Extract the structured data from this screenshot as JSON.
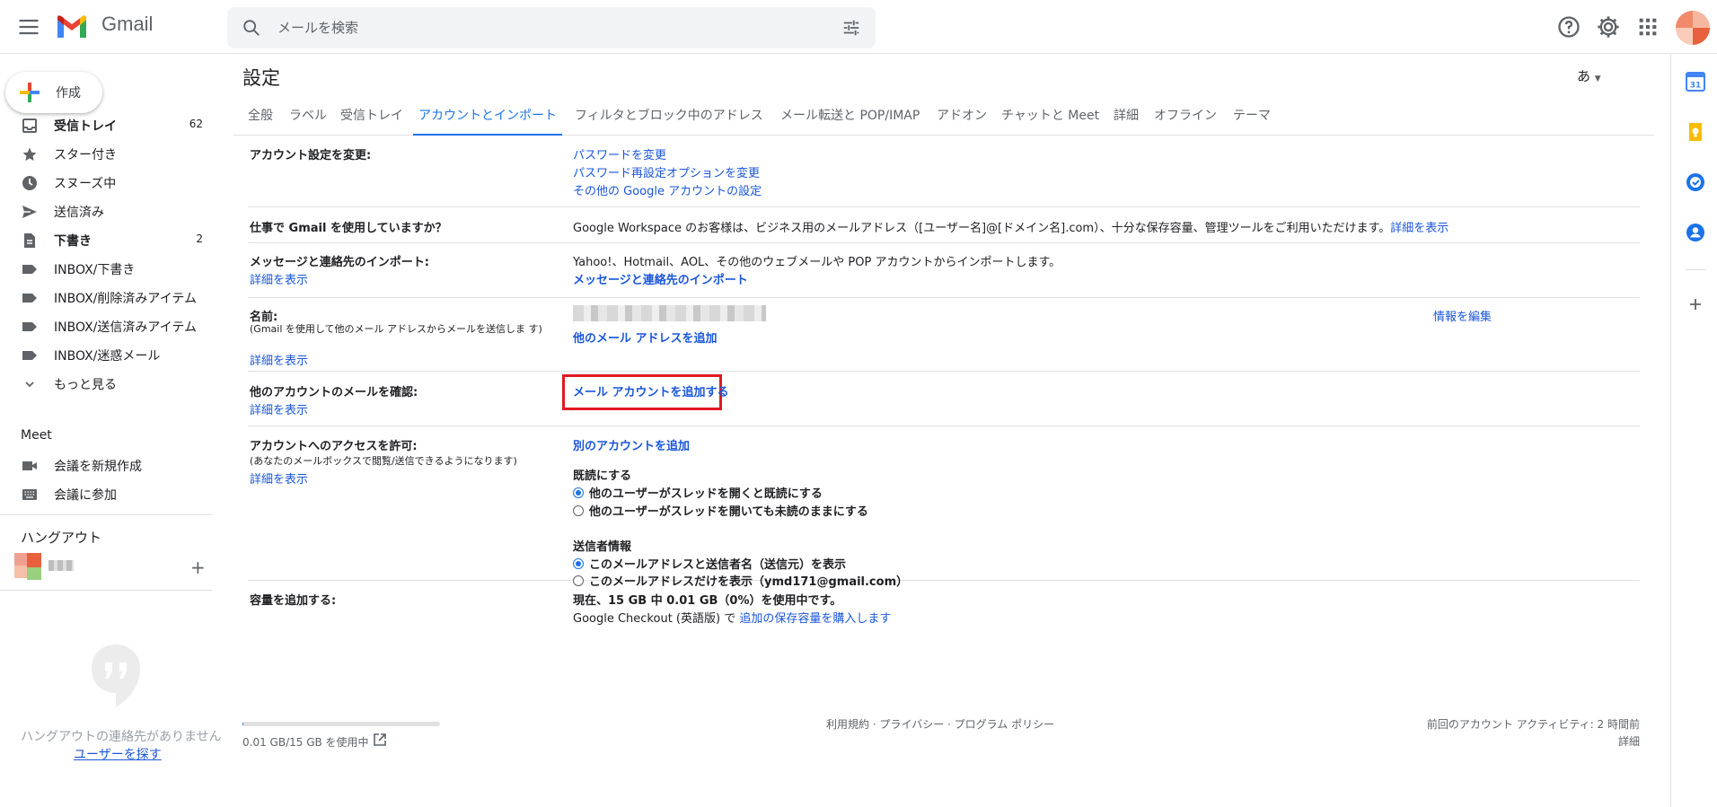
{
  "header": {
    "app_name": "Gmail",
    "search_placeholder": "メールを検索"
  },
  "sidebar": {
    "compose_label": "作成",
    "items": [
      {
        "label": "受信トレイ",
        "count": "62",
        "icon": "inbox-icon",
        "bold": true
      },
      {
        "label": "スター付き",
        "count": "",
        "icon": "star-icon",
        "bold": false
      },
      {
        "label": "スヌーズ中",
        "count": "",
        "icon": "clock-icon",
        "bold": false
      },
      {
        "label": "送信済み",
        "count": "",
        "icon": "send-icon",
        "bold": false
      },
      {
        "label": "下書き",
        "count": "2",
        "icon": "draft-icon",
        "bold": true
      },
      {
        "label": "INBOX/下書き",
        "count": "",
        "icon": "label-icon",
        "bold": false
      },
      {
        "label": "INBOX/削除済みアイテム",
        "count": "",
        "icon": "label-icon",
        "bold": false
      },
      {
        "label": "INBOX/送信済みアイテム",
        "count": "",
        "icon": "label-icon",
        "bold": false
      },
      {
        "label": "INBOX/迷惑メール",
        "count": "",
        "icon": "label-icon",
        "bold": false
      },
      {
        "label": "もっと見る",
        "count": "",
        "icon": "chevron-down-icon",
        "bold": false
      }
    ],
    "meet": {
      "title": "Meet",
      "new_meeting": "会議を新規作成",
      "join_meeting": "会議に参加"
    },
    "hangouts": {
      "title": "ハングアウト",
      "empty_text": "ハングアウトの連絡先がありません",
      "find_users": "ユーザーを探す"
    }
  },
  "settings": {
    "title": "設定",
    "lang_button": "あ",
    "tabs": [
      "全般",
      "ラベル",
      "受信トレイ",
      "アカウントとインポート",
      "フィルタとブロック中のアドレス",
      "メール転送と POP/IMAP",
      "アドオン",
      "チャットと Meet",
      "詳細",
      "オフライン",
      "テーマ"
    ],
    "active_tab": "アカウントとインポート",
    "rows": {
      "change_account": {
        "label": "アカウント設定を変更:",
        "links": [
          "パスワードを変更",
          "パスワード再設定オプションを変更",
          "その他の Google アカウントの設定"
        ]
      },
      "workspace": {
        "label": "仕事で Gmail を使用していますか？",
        "text": "Google Workspace のお客様は、ビジネス用のメールアドレス（[ユーザー名]@[ドメイン名].com）、十分な保存容量、管理ツールをご利用いただけます。",
        "link": "詳細を表示"
      },
      "import": {
        "label": "メッセージと連絡先のインポート:",
        "more": "詳細を表示",
        "text": "Yahoo!、Hotmail、AOL、その他のウェブメールや POP アカウントからインポートします。",
        "link": "メッセージと連絡先のインポート"
      },
      "name": {
        "label": "名前:",
        "sub": "(Gmail を使用して他のメール アドレスからメールを送信しま す)",
        "more": "詳細を表示",
        "link": "他のメール アドレスを追加",
        "edit": "情報を編集"
      },
      "check_mail": {
        "label": "他のアカウントのメールを確認:",
        "more": "詳細を表示",
        "link": "メール アカウントを追加する"
      },
      "grant_access": {
        "label": "アカウントへのアクセスを許可:",
        "sub": "(あなたのメールボックスで閲覧/送信できるようになります)",
        "more": "詳細を表示",
        "link": "別のアカウントを追加",
        "read_title": "既読にする",
        "read_options": [
          "他のユーザーがスレッドを開くと既読にする",
          "他のユーザーがスレッドを開いても未読のままにする"
        ],
        "sender_title": "送信者情報",
        "sender_options": [
          "このメールアドレスと送信者名（送信元）を表示",
          "このメールアドレスだけを表示（ymd171@gmail.com）"
        ]
      },
      "storage": {
        "label": "容量を追加する:",
        "usage": "現在、15 GB 中 0.01 GB（0%）を使用中です。",
        "checkout": "Google Checkout (英語版) で",
        "buy_link": "追加の保存容量を購入します"
      }
    },
    "footer": {
      "storage": "0.01 GB/15 GB を使用中",
      "storage_fraction": 0.001,
      "terms": "利用規約 · プライバシー · プログラム ポリシー",
      "activity": "前回のアカウント アクティビティ: 2 時間前",
      "details": "詳細"
    }
  },
  "right_rail": {
    "calendar_day": "31"
  },
  "colors": {
    "link": "#1a56db",
    "accent": "#1a73e8",
    "highlight": "#e01a22"
  }
}
